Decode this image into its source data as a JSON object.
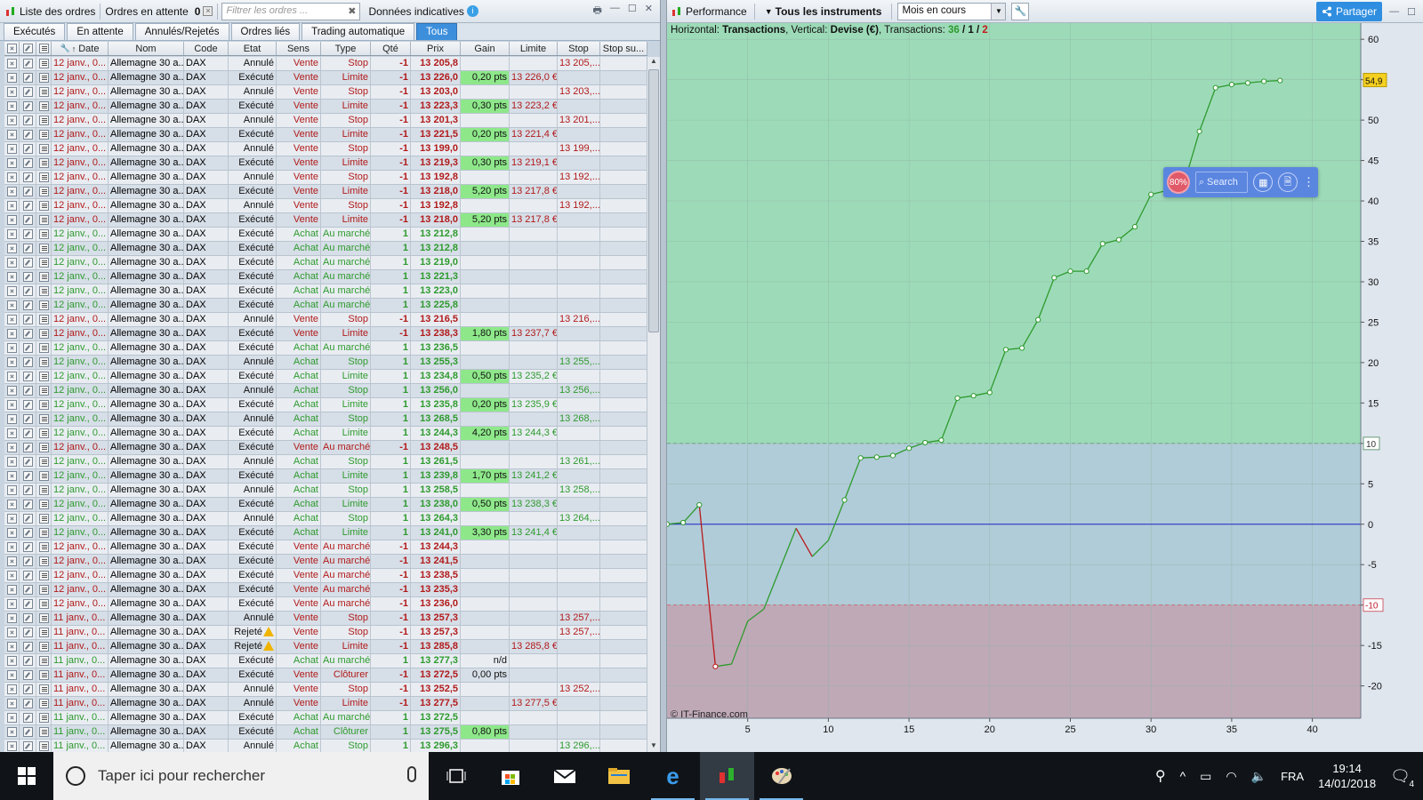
{
  "left_panel": {
    "title": "Liste des ordres",
    "pending_label": "Ordres en attente",
    "pending_count": "0",
    "filter_placeholder": "Filtrer les ordres ...",
    "indicative_label": "Données indicatives",
    "tabs": [
      "Exécutés",
      "En attente",
      "Annulés/Rejetés",
      "Ordres liés",
      "Trading automatique",
      "Tous"
    ],
    "active_tab": "Tous",
    "columns": [
      "Date",
      "Nom",
      "Code",
      "Etat",
      "Sens",
      "Type",
      "Qté",
      "Prix",
      "Gain",
      "Limite",
      "Stop",
      "Stop su..."
    ],
    "rows": [
      [
        "12 janv., 0...",
        "Allemagne 30 a...",
        "DAX",
        "Annulé",
        "Vente",
        "Stop",
        "-1",
        "13 205,8",
        "",
        "",
        "13 205,..."
      ],
      [
        "12 janv., 0...",
        "Allemagne 30 a...",
        "DAX",
        "Exécuté",
        "Vente",
        "Limite",
        "-1",
        "13 226,0",
        "0,20 pts",
        "13 226,0 €",
        ""
      ],
      [
        "12 janv., 0...",
        "Allemagne 30 a...",
        "DAX",
        "Annulé",
        "Vente",
        "Stop",
        "-1",
        "13 203,0",
        "",
        "",
        "13 203,..."
      ],
      [
        "12 janv., 0...",
        "Allemagne 30 a...",
        "DAX",
        "Exécuté",
        "Vente",
        "Limite",
        "-1",
        "13 223,3",
        "0,30 pts",
        "13 223,2 €",
        ""
      ],
      [
        "12 janv., 0...",
        "Allemagne 30 a...",
        "DAX",
        "Annulé",
        "Vente",
        "Stop",
        "-1",
        "13 201,3",
        "",
        "",
        "13 201,..."
      ],
      [
        "12 janv., 0...",
        "Allemagne 30 a...",
        "DAX",
        "Exécuté",
        "Vente",
        "Limite",
        "-1",
        "13 221,5",
        "0,20 pts",
        "13 221,4 €",
        ""
      ],
      [
        "12 janv., 0...",
        "Allemagne 30 a...",
        "DAX",
        "Annulé",
        "Vente",
        "Stop",
        "-1",
        "13 199,0",
        "",
        "",
        "13 199,..."
      ],
      [
        "12 janv., 0...",
        "Allemagne 30 a...",
        "DAX",
        "Exécuté",
        "Vente",
        "Limite",
        "-1",
        "13 219,3",
        "0,30 pts",
        "13 219,1 €",
        ""
      ],
      [
        "12 janv., 0...",
        "Allemagne 30 a...",
        "DAX",
        "Annulé",
        "Vente",
        "Stop",
        "-1",
        "13 192,8",
        "",
        "",
        "13 192,..."
      ],
      [
        "12 janv., 0...",
        "Allemagne 30 a...",
        "DAX",
        "Exécuté",
        "Vente",
        "Limite",
        "-1",
        "13 218,0",
        "5,20 pts",
        "13 217,8 €",
        ""
      ],
      [
        "12 janv., 0...",
        "Allemagne 30 a...",
        "DAX",
        "Annulé",
        "Vente",
        "Stop",
        "-1",
        "13 192,8",
        "",
        "",
        "13 192,..."
      ],
      [
        "12 janv., 0...",
        "Allemagne 30 a...",
        "DAX",
        "Exécuté",
        "Vente",
        "Limite",
        "-1",
        "13 218,0",
        "5,20 pts",
        "13 217,8 €",
        ""
      ],
      [
        "12 janv., 0...",
        "Allemagne 30 a...",
        "DAX",
        "Exécuté",
        "Achat",
        "Au marché",
        "1",
        "13 212,8",
        "",
        "",
        ""
      ],
      [
        "12 janv., 0...",
        "Allemagne 30 a...",
        "DAX",
        "Exécuté",
        "Achat",
        "Au marché",
        "1",
        "13 212,8",
        "",
        "",
        ""
      ],
      [
        "12 janv., 0...",
        "Allemagne 30 a...",
        "DAX",
        "Exécuté",
        "Achat",
        "Au marché",
        "1",
        "13 219,0",
        "",
        "",
        ""
      ],
      [
        "12 janv., 0...",
        "Allemagne 30 a...",
        "DAX",
        "Exécuté",
        "Achat",
        "Au marché",
        "1",
        "13 221,3",
        "",
        "",
        ""
      ],
      [
        "12 janv., 0...",
        "Allemagne 30 a...",
        "DAX",
        "Exécuté",
        "Achat",
        "Au marché",
        "1",
        "13 223,0",
        "",
        "",
        ""
      ],
      [
        "12 janv., 0...",
        "Allemagne 30 a...",
        "DAX",
        "Exécuté",
        "Achat",
        "Au marché",
        "1",
        "13 225,8",
        "",
        "",
        ""
      ],
      [
        "12 janv., 0...",
        "Allemagne 30 a...",
        "DAX",
        "Annulé",
        "Vente",
        "Stop",
        "-1",
        "13 216,5",
        "",
        "",
        "13 216,..."
      ],
      [
        "12 janv., 0...",
        "Allemagne 30 a...",
        "DAX",
        "Exécuté",
        "Vente",
        "Limite",
        "-1",
        "13 238,3",
        "1,80 pts",
        "13 237,7 €",
        ""
      ],
      [
        "12 janv., 0...",
        "Allemagne 30 a...",
        "DAX",
        "Exécuté",
        "Achat",
        "Au marché",
        "1",
        "13 236,5",
        "",
        "",
        ""
      ],
      [
        "12 janv., 0...",
        "Allemagne 30 a...",
        "DAX",
        "Annulé",
        "Achat",
        "Stop",
        "1",
        "13 255,3",
        "",
        "",
        "13 255,..."
      ],
      [
        "12 janv., 0...",
        "Allemagne 30 a...",
        "DAX",
        "Exécuté",
        "Achat",
        "Limite",
        "1",
        "13 234,8",
        "0,50 pts",
        "13 235,2 €",
        ""
      ],
      [
        "12 janv., 0...",
        "Allemagne 30 a...",
        "DAX",
        "Annulé",
        "Achat",
        "Stop",
        "1",
        "13 256,0",
        "",
        "",
        "13 256,..."
      ],
      [
        "12 janv., 0...",
        "Allemagne 30 a...",
        "DAX",
        "Exécuté",
        "Achat",
        "Limite",
        "1",
        "13 235,8",
        "0,20 pts",
        "13 235,9 €",
        ""
      ],
      [
        "12 janv., 0...",
        "Allemagne 30 a...",
        "DAX",
        "Annulé",
        "Achat",
        "Stop",
        "1",
        "13 268,5",
        "",
        "",
        "13 268,..."
      ],
      [
        "12 janv., 0...",
        "Allemagne 30 a...",
        "DAX",
        "Exécuté",
        "Achat",
        "Limite",
        "1",
        "13 244,3",
        "4,20 pts",
        "13 244,3 €",
        ""
      ],
      [
        "12 janv., 0...",
        "Allemagne 30 a...",
        "DAX",
        "Exécuté",
        "Vente",
        "Au marché",
        "-1",
        "13 248,5",
        "",
        "",
        ""
      ],
      [
        "12 janv., 0...",
        "Allemagne 30 a...",
        "DAX",
        "Annulé",
        "Achat",
        "Stop",
        "1",
        "13 261,5",
        "",
        "",
        "13 261,..."
      ],
      [
        "12 janv., 0...",
        "Allemagne 30 a...",
        "DAX",
        "Exécuté",
        "Achat",
        "Limite",
        "1",
        "13 239,8",
        "1,70 pts",
        "13 241,2 €",
        ""
      ],
      [
        "12 janv., 0...",
        "Allemagne 30 a...",
        "DAX",
        "Annulé",
        "Achat",
        "Stop",
        "1",
        "13 258,5",
        "",
        "",
        "13 258,..."
      ],
      [
        "12 janv., 0...",
        "Allemagne 30 a...",
        "DAX",
        "Exécuté",
        "Achat",
        "Limite",
        "1",
        "13 238,0",
        "0,50 pts",
        "13 238,3 €",
        ""
      ],
      [
        "12 janv., 0...",
        "Allemagne 30 a...",
        "DAX",
        "Annulé",
        "Achat",
        "Stop",
        "1",
        "13 264,3",
        "",
        "",
        "13 264,..."
      ],
      [
        "12 janv., 0...",
        "Allemagne 30 a...",
        "DAX",
        "Exécuté",
        "Achat",
        "Limite",
        "1",
        "13 241,0",
        "3,30 pts",
        "13 241,4 €",
        ""
      ],
      [
        "12 janv., 0...",
        "Allemagne 30 a...",
        "DAX",
        "Exécuté",
        "Vente",
        "Au marché",
        "-1",
        "13 244,3",
        "",
        "",
        ""
      ],
      [
        "12 janv., 0...",
        "Allemagne 30 a...",
        "DAX",
        "Exécuté",
        "Vente",
        "Au marché",
        "-1",
        "13 241,5",
        "",
        "",
        ""
      ],
      [
        "12 janv., 0...",
        "Allemagne 30 a...",
        "DAX",
        "Exécuté",
        "Vente",
        "Au marché",
        "-1",
        "13 238,5",
        "",
        "",
        ""
      ],
      [
        "12 janv., 0...",
        "Allemagne 30 a...",
        "DAX",
        "Exécuté",
        "Vente",
        "Au marché",
        "-1",
        "13 235,3",
        "",
        "",
        ""
      ],
      [
        "12 janv., 0...",
        "Allemagne 30 a...",
        "DAX",
        "Exécuté",
        "Vente",
        "Au marché",
        "-1",
        "13 236,0",
        "",
        "",
        ""
      ],
      [
        "11 janv., 0...",
        "Allemagne 30 a...",
        "DAX",
        "Annulé",
        "Vente",
        "Stop",
        "-1",
        "13 257,3",
        "",
        "",
        "13 257,..."
      ],
      [
        "11 janv., 0...",
        "Allemagne 30 a...",
        "DAX",
        "Rejeté",
        "Vente",
        "Stop",
        "-1",
        "13 257,3",
        "",
        "",
        "13 257,..."
      ],
      [
        "11 janv., 0...",
        "Allemagne 30 a...",
        "DAX",
        "Rejeté",
        "Vente",
        "Limite",
        "-1",
        "13 285,8",
        "",
        "13 285,8 €",
        ""
      ],
      [
        "11 janv., 0...",
        "Allemagne 30 a...",
        "DAX",
        "Exécuté",
        "Achat",
        "Au marché",
        "1",
        "13 277,3",
        "n/d",
        "",
        ""
      ],
      [
        "11 janv., 0...",
        "Allemagne 30 a...",
        "DAX",
        "Exécuté",
        "Vente",
        "Clôturer",
        "-1",
        "13 272,5",
        "0,00 pts",
        "",
        ""
      ],
      [
        "11 janv., 0...",
        "Allemagne 30 a...",
        "DAX",
        "Annulé",
        "Vente",
        "Stop",
        "-1",
        "13 252,5",
        "",
        "",
        "13 252,..."
      ],
      [
        "11 janv., 0...",
        "Allemagne 30 a...",
        "DAX",
        "Annulé",
        "Vente",
        "Limite",
        "-1",
        "13 277,5",
        "",
        "13 277,5 €",
        ""
      ],
      [
        "11 janv., 0...",
        "Allemagne 30 a...",
        "DAX",
        "Exécuté",
        "Achat",
        "Au marché",
        "1",
        "13 272,5",
        "",
        "",
        ""
      ],
      [
        "11 janv., 0...",
        "Allemagne 30 a...",
        "DAX",
        "Exécuté",
        "Achat",
        "Clôturer",
        "1",
        "13 275,5",
        "0,80 pts",
        "",
        ""
      ],
      [
        "11 janv., 0...",
        "Allemagne 30 a...",
        "DAX",
        "Annulé",
        "Achat",
        "Stop",
        "1",
        "13 296,3",
        "",
        "",
        "13 296,..."
      ]
    ]
  },
  "right_panel": {
    "title": "Performance",
    "instruments_label": "Tous les instruments",
    "period_value": "Mois en cours",
    "share_label": "Partager",
    "info_prefix_h": "Horizontal:",
    "info_h_value": "Transactions",
    "info_prefix_v": "Vertical:",
    "info_v_value": "Devise (€)",
    "info_prefix_t": "Transactions:",
    "info_t_total": "36",
    "info_t_sep1": "/",
    "info_t_win": "1",
    "info_t_sep2": "/",
    "info_t_loss": "2",
    "copyright": "© IT-Finance.com",
    "last_value_label": "54,9",
    "upper_threshold_label": "10",
    "lower_threshold_label": "-10",
    "overlay": {
      "zoom": "80%",
      "search_label": "Search"
    }
  },
  "chart_data": {
    "type": "line",
    "x": [
      0,
      1,
      2,
      3,
      4,
      5,
      6,
      7,
      8,
      9,
      10,
      11,
      12,
      13,
      14,
      15,
      16,
      17,
      18,
      19,
      20,
      21,
      22,
      23,
      24,
      25,
      26,
      27,
      28,
      29,
      30,
      31,
      32,
      33,
      34,
      35,
      36,
      37,
      38,
      39
    ],
    "y": [
      0,
      0.2,
      2.4,
      -17.6,
      -17.3,
      -12,
      -10.5,
      -5.5,
      -0.5,
      -4,
      -2,
      3,
      8.2,
      8.3,
      8.5,
      9.4,
      10.1,
      10.4,
      15.6,
      15.9,
      16.3,
      21.6,
      21.8,
      25.3,
      30.5,
      31.3,
      31.3,
      34.7,
      35.2,
      36.8,
      40.8,
      41.3,
      41.8,
      48.6,
      54,
      54.4,
      54.6,
      54.8,
      54.9
    ],
    "x_ticks": [
      "5",
      "10",
      "15",
      "20",
      "25",
      "30",
      "35",
      "40"
    ],
    "y_ticks": [
      "60",
      "55",
      "50",
      "45",
      "40",
      "35",
      "30",
      "25",
      "20",
      "15",
      "10",
      "5",
      "0",
      "-5",
      "-10",
      "-15",
      "-20"
    ],
    "xlim": [
      0,
      43
    ],
    "ylim": [
      -24,
      62
    ],
    "upper_threshold": 10,
    "lower_threshold": -10,
    "colors": {
      "gain_zone": "#9ddbb8",
      "neutral_zone": "#b0ccd8",
      "loss_zone": "#c0a9b7",
      "gain_line": "#2e9a2e",
      "loss_line": "#b71b1b",
      "zero_line": "#2222cc"
    }
  },
  "taskbar": {
    "search_placeholder": "Taper ici pour rechercher",
    "language": "FRA",
    "time": "19:14",
    "date": "14/01/2018",
    "notifications": "4"
  }
}
